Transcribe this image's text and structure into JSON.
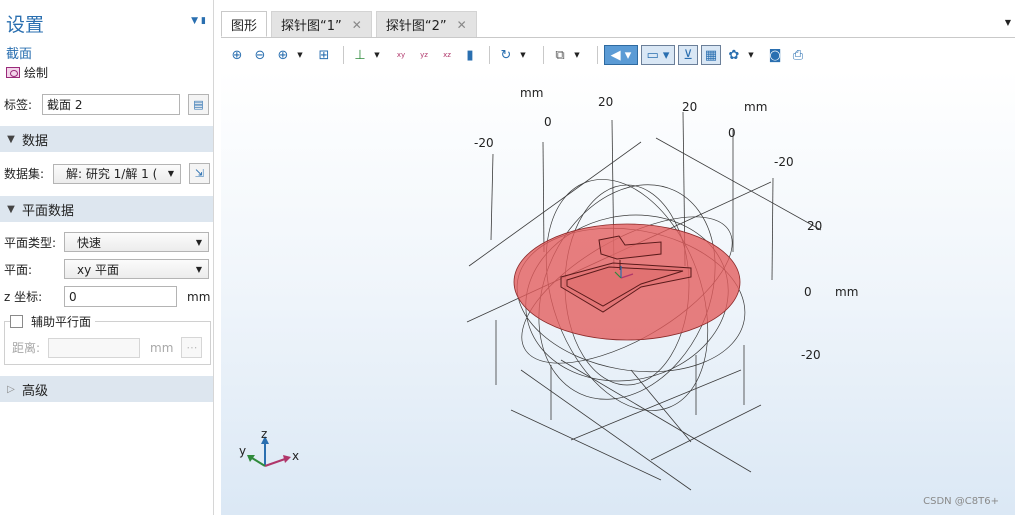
{
  "settings": {
    "title": "设置",
    "subtitle": "截面",
    "draw_label": "绘制",
    "label_field": {
      "label": "标签:",
      "value": "截面 2"
    },
    "sections": {
      "data": "数据",
      "plane_data": "平面数据",
      "advanced": "高级"
    },
    "dataset": {
      "label": "数据集:",
      "value": "解: 研究 1/解 1 ("
    },
    "plane_type": {
      "label": "平面类型:",
      "value": "快速"
    },
    "plane": {
      "label": "平面:",
      "value": "xy 平面"
    },
    "z_coord": {
      "label": "z 坐标:",
      "value": "0",
      "unit": "mm"
    },
    "aux_planes": {
      "label": "辅助平行面",
      "checked": false
    },
    "distance": {
      "label": "距离:",
      "value": "",
      "unit": "mm"
    }
  },
  "tabs": [
    {
      "label": "图形",
      "active": true
    },
    {
      "label": "探针图“1”",
      "active": false
    },
    {
      "label": "探针图“2”",
      "active": false
    }
  ],
  "toolbar": {
    "icons": [
      "zoom-in-icon",
      "zoom-out-icon",
      "zoom-box-icon",
      "zoom-extents-icon",
      "axes-orientation-icon",
      "view-xy-icon",
      "view-yz-icon",
      "view-zx-icon",
      "view-2d-icon",
      "rotate-icon",
      "views-icon",
      "light-icon",
      "transparency-icon",
      "grid-icon",
      "show-grid-icon",
      "render-icon",
      "camera-icon",
      "print-icon"
    ],
    "labels": {
      "xy": "xy",
      "yz": "yz",
      "xz": "xz"
    }
  },
  "viewport": {
    "axis_labels": {
      "top_unit": "mm",
      "top_20_a": "20",
      "top_20_b": "20",
      "top_unit_b": "mm",
      "top_0_a": "0",
      "top_0_b": "0",
      "neg20_left": "-20",
      "neg20_right": "-20",
      "right_20": "20",
      "right_0": "0",
      "right_unit": "mm",
      "right_neg20": "-20"
    },
    "triad": {
      "x": "x",
      "y": "y",
      "z": "z"
    },
    "colors": {
      "plane_fill": "#e35b5b",
      "plane_stroke": "#8c2a2a",
      "line": "#3a3a3a"
    }
  },
  "watermark": "CSDN @C8T6+"
}
